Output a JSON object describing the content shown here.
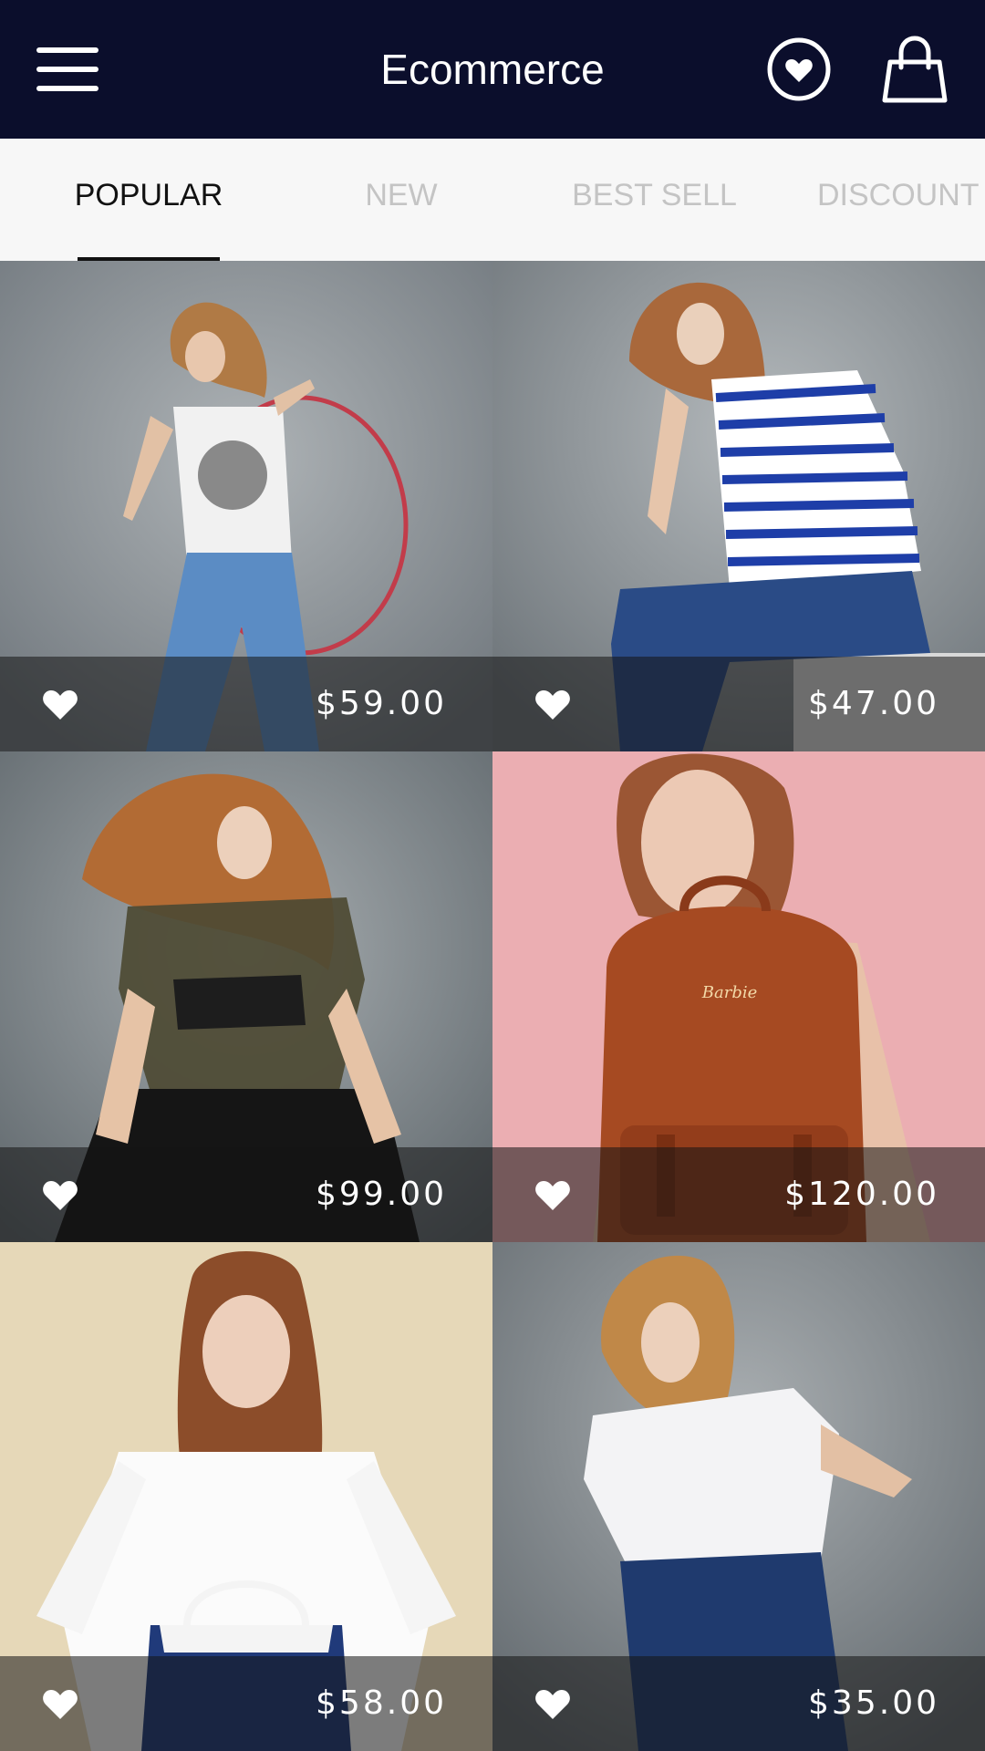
{
  "header": {
    "menu_icon": "hamburger-menu-icon",
    "title": "Ecommerce",
    "wishlist_icon": "heart-circle-icon",
    "cart_icon": "shopping-bag-icon",
    "background": "#0b0e2c"
  },
  "tabs": [
    {
      "label": "POPULAR",
      "active": true
    },
    {
      "label": "NEW",
      "active": false
    },
    {
      "label": "BEST SELL",
      "active": false
    },
    {
      "label": "DISCOUNT",
      "active": false
    }
  ],
  "products": [
    {
      "price": "$59.00",
      "image": "model in graphic tank top and light jeans holding hoop",
      "bg": "#8a9095"
    },
    {
      "price": "$47.00",
      "image": "model in blue striped t-shirt and dark jeans",
      "bg": "#8d9397"
    },
    {
      "price": "$99.00",
      "image": "model in sheer black top and black jeans",
      "bg": "#7e858a"
    },
    {
      "price": "$120.00",
      "image": "model holding brown leather backpack on pink backdrop",
      "bg": "#e9a9ae"
    },
    {
      "price": "$58.00",
      "image": "model in white blouse holding navy handbag",
      "bg": "#e3d6b6"
    },
    {
      "price": "$35.00",
      "image": "model in white top and high-waist navy jeans",
      "bg": "#858b8f"
    }
  ],
  "icons": {
    "favorite": "heart-icon"
  }
}
